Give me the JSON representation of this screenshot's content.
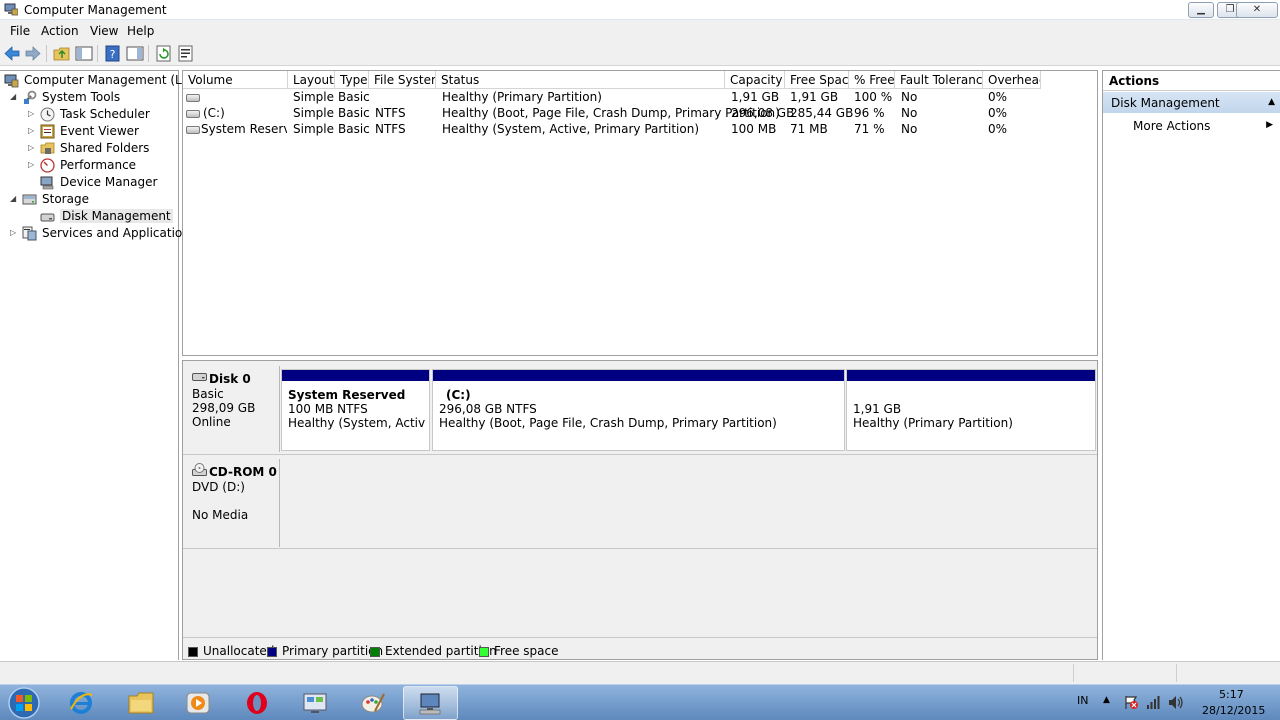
{
  "window": {
    "title": "Computer Management"
  },
  "menu": [
    "File",
    "Action",
    "View",
    "Help"
  ],
  "tree": {
    "root": "Computer Management (Local",
    "system_tools": "System Tools",
    "task_scheduler": "Task Scheduler",
    "event_viewer": "Event Viewer",
    "shared_folders": "Shared Folders",
    "performance": "Performance",
    "device_manager": "Device Manager",
    "storage": "Storage",
    "disk_management": "Disk Management",
    "services": "Services and Applications"
  },
  "volumes": {
    "columns": [
      "Volume",
      "Layout",
      "Type",
      "File System",
      "Status",
      "Capacity",
      "Free Space",
      "% Free",
      "Fault Tolerance",
      "Overhead"
    ],
    "rows": [
      [
        "",
        "Simple",
        "Basic",
        "",
        "Healthy (Primary Partition)",
        "1,91 GB",
        "1,91 GB",
        "100 %",
        "No",
        "0%"
      ],
      [
        "(C:)",
        "Simple",
        "Basic",
        "NTFS",
        "Healthy (Boot, Page File, Crash Dump, Primary Partition)",
        "296,08 GB",
        "285,44 GB",
        "96 %",
        "No",
        "0%"
      ],
      [
        "System Reserved",
        "Simple",
        "Basic",
        "NTFS",
        "Healthy (System, Active, Primary Partition)",
        "100 MB",
        "71 MB",
        "71 %",
        "No",
        "0%"
      ]
    ]
  },
  "disk0": {
    "name": "Disk 0",
    "type": "Basic",
    "size": "298,09 GB",
    "state": "Online",
    "partitions": [
      {
        "name": "System Reserved",
        "size": "100 MB NTFS",
        "status": "Healthy (System, Active, Pri"
      },
      {
        "name": "(C:)",
        "size": "296,08 GB NTFS",
        "status": "Healthy (Boot, Page File, Crash Dump, Primary Partition)"
      },
      {
        "name": "",
        "size": "1,91 GB",
        "status": "Healthy (Primary Partition)"
      }
    ]
  },
  "cdrom0": {
    "name": "CD-ROM 0",
    "drive": "DVD (D:)",
    "media": "No Media"
  },
  "legend": [
    {
      "label": "Unallocated",
      "color": "#000000"
    },
    {
      "label": "Primary partition",
      "color": "#000080"
    },
    {
      "label": "Extended partition",
      "color": "#008000"
    },
    {
      "label": "Free space",
      "color": "#33ff33"
    }
  ],
  "actions": {
    "header": "Actions",
    "section": "Disk Management",
    "more": "More Actions"
  },
  "tray": {
    "lang": "IN",
    "time": "5:17",
    "date": "28/12/2015"
  }
}
